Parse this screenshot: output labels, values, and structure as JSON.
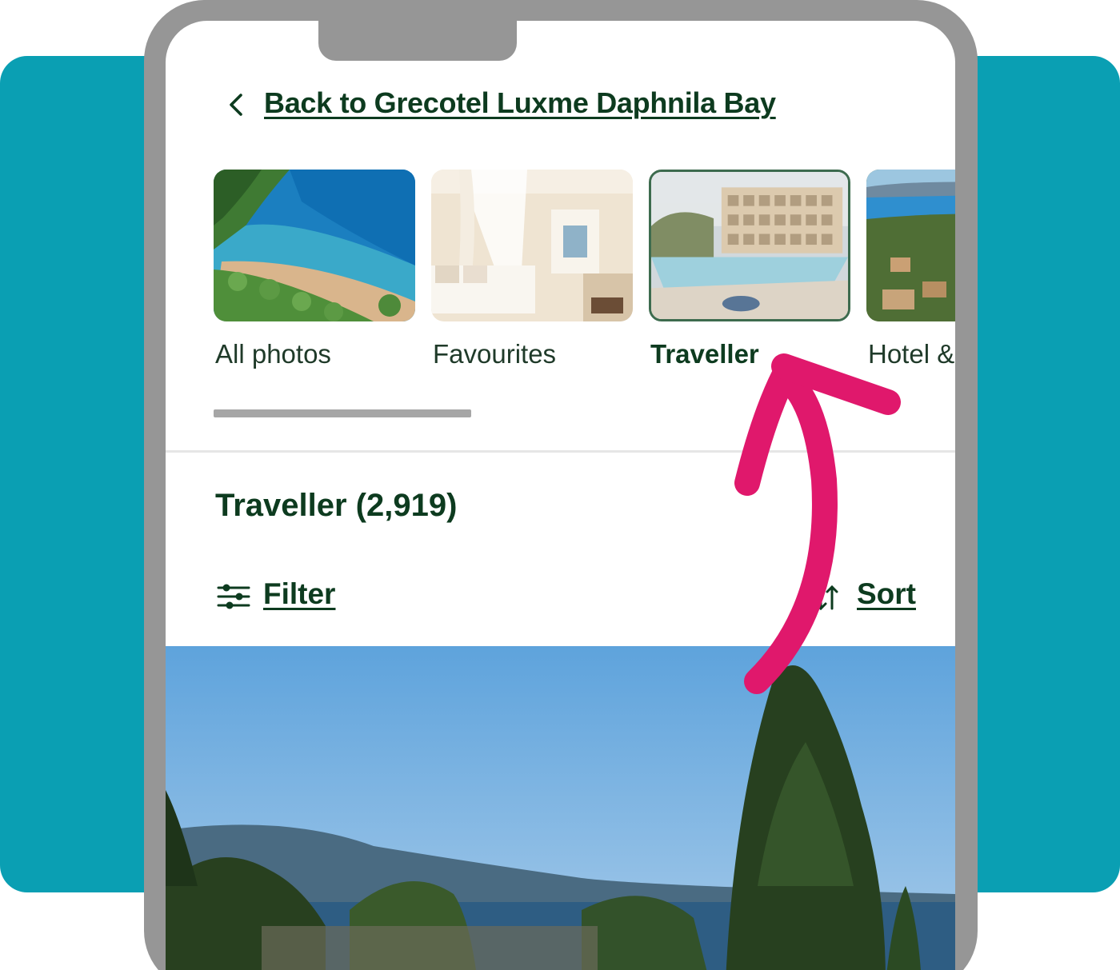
{
  "header": {
    "back_label": "Back to Grecotel Luxme Daphnila Bay"
  },
  "categories": [
    {
      "label": "All photos",
      "icon": "beach-thumbnail",
      "selected": false
    },
    {
      "label": "Favourites",
      "icon": "bedroom-thumbnail",
      "selected": false
    },
    {
      "label": "Traveller",
      "icon": "pool-hotel-thumbnail",
      "selected": true
    },
    {
      "label": "Hotel & Amenit",
      "icon": "aerial-resort-thumbnail",
      "selected": false
    }
  ],
  "section": {
    "title": "Traveller (2,919)"
  },
  "toolbar": {
    "filter_label": "Filter",
    "sort_label": "Sort"
  },
  "colors": {
    "background_accent": "#0a9fb3",
    "phone_frame": "#969696",
    "text_primary": "#0d3b1f",
    "annotation_arrow": "#e0186c"
  }
}
